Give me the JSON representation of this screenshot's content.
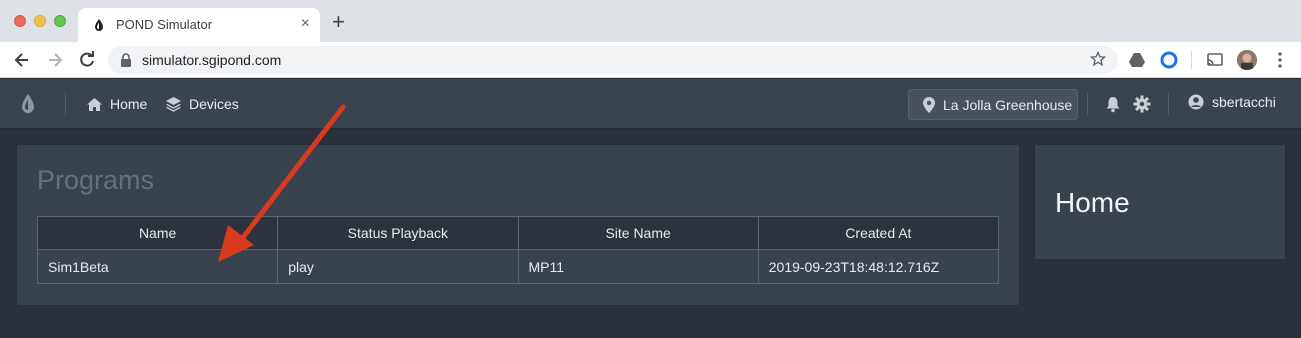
{
  "browser": {
    "tab_title": "POND Simulator",
    "tab_close": "×",
    "new_tab": "+",
    "url": "simulator.sgipond.com"
  },
  "navbar": {
    "home_label": "Home",
    "devices_label": "Devices",
    "location_label": "La Jolla Greenhouse",
    "username": "sbertacchi"
  },
  "programs": {
    "title": "Programs",
    "columns": [
      "Name",
      "Status Playback",
      "Site Name",
      "Created At"
    ],
    "rows": [
      [
        "Sim1Beta",
        "play",
        "MP11",
        "2019-09-23T18:48:12.716Z"
      ]
    ]
  },
  "home_panel": {
    "title": "Home"
  },
  "colors": {
    "navbar": "#3a444f",
    "panel": "#39434e",
    "background": "#2b313a",
    "annotation_arrow": "#d93a1e"
  }
}
